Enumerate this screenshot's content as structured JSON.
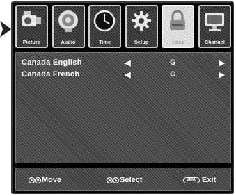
{
  "tabs": [
    {
      "label": "Picture",
      "icon": "camcorder-icon",
      "active": false
    },
    {
      "label": "Audio",
      "icon": "speaker-icon",
      "active": false
    },
    {
      "label": "Time",
      "icon": "clock-icon",
      "active": false
    },
    {
      "label": "Setup",
      "icon": "gear-icon",
      "active": false
    },
    {
      "label": "Lock",
      "icon": "padlock-icon",
      "active": true
    },
    {
      "label": "Channel",
      "icon": "tv-icon",
      "active": false
    }
  ],
  "menu": {
    "items": [
      {
        "label": "Canada English",
        "value": "G",
        "left_arrow": "◀",
        "right_arrow": "▶"
      },
      {
        "label": "Canada French",
        "value": "G",
        "left_arrow": "◀",
        "right_arrow": "▶"
      }
    ]
  },
  "footer": {
    "move": "Move",
    "select": "Select",
    "exit": "Exit",
    "exit_key": "MENU"
  },
  "colors": {
    "text": "#ffffff",
    "active_tab": "#e0e0e0",
    "inactive_tab": "#3a3a3a"
  }
}
